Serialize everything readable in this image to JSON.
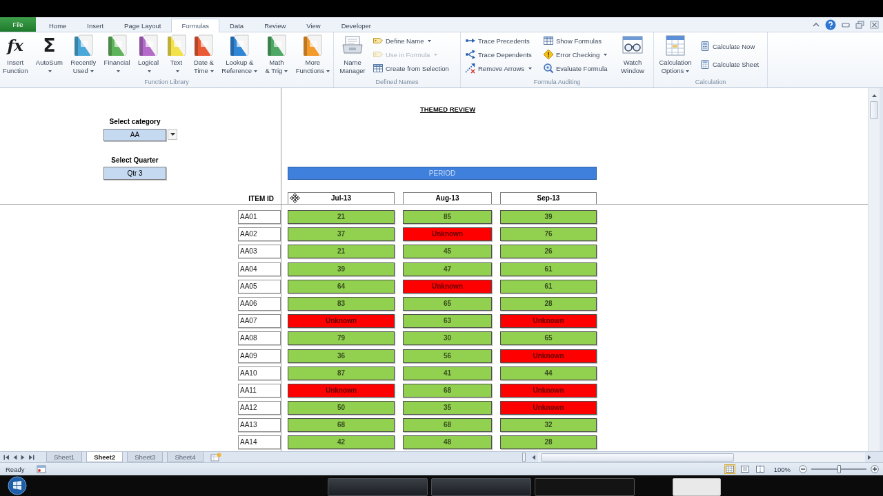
{
  "file_button": {
    "label": "File"
  },
  "tabs": [
    {
      "label": "Home",
      "selected": false
    },
    {
      "label": "Insert",
      "selected": false
    },
    {
      "label": "Page Layout",
      "selected": false
    },
    {
      "label": "Formulas",
      "selected": true
    },
    {
      "label": "Data",
      "selected": false
    },
    {
      "label": "Review",
      "selected": false
    },
    {
      "label": "View",
      "selected": false
    },
    {
      "label": "Developer",
      "selected": false
    }
  ],
  "function_library": {
    "label": "Function Library",
    "buttons": [
      {
        "kind": "glyph",
        "glyph": "fx",
        "lines": [
          "Insert",
          "Function"
        ],
        "menu": false
      },
      {
        "kind": "glyph",
        "glyph": "Σ",
        "lines": [
          "AutoSum"
        ],
        "menu": true
      },
      {
        "kind": "book",
        "color": "#4aa8d8",
        "lines": [
          "Recently",
          "Used"
        ],
        "menu": true
      },
      {
        "kind": "book",
        "color": "#5fb35a",
        "lines": [
          "Financial"
        ],
        "menu": true
      },
      {
        "kind": "book",
        "color": "#b46ac9",
        "lines": [
          "Logical"
        ],
        "menu": true
      },
      {
        "kind": "book",
        "color": "#f2e14a",
        "lines": [
          "Text"
        ],
        "menu": true
      },
      {
        "kind": "book",
        "color": "#ea5b35",
        "lines": [
          "Date &",
          "Time"
        ],
        "menu": true
      },
      {
        "kind": "book",
        "color": "#2f86d6",
        "lines": [
          "Lookup &",
          "Reference"
        ],
        "menu": true
      },
      {
        "kind": "book",
        "color": "#4ea865",
        "lines": [
          "Math",
          "& Trig"
        ],
        "menu": true
      },
      {
        "kind": "book",
        "color": "#f39a2c",
        "lines": [
          "More",
          "Functions"
        ],
        "menu": true
      }
    ]
  },
  "defined_names": {
    "label": "Defined Names",
    "manager": {
      "lines": [
        "Name",
        "Manager"
      ]
    },
    "items": [
      {
        "label": "Define Name",
        "menu": true,
        "disabled": false
      },
      {
        "label": "Use in Formula",
        "menu": true,
        "disabled": true
      },
      {
        "label": "Create from Selection",
        "menu": false,
        "disabled": false
      }
    ]
  },
  "formula_auditing": {
    "label": "Formula Auditing",
    "columns": [
      {
        "items": [
          {
            "label": "Trace Precedents",
            "menu": false
          },
          {
            "label": "Trace Dependents",
            "menu": false
          },
          {
            "label": "Remove Arrows",
            "menu": true
          }
        ]
      },
      {
        "items": [
          {
            "label": "Show Formulas",
            "menu": false
          },
          {
            "label": "Error Checking",
            "menu": true
          },
          {
            "label": "Evaluate Formula",
            "menu": false
          }
        ]
      }
    ],
    "watch": {
      "lines": [
        "Watch",
        "Window"
      ]
    }
  },
  "calculation": {
    "label": "Calculation",
    "options": {
      "lines": [
        "Calculation",
        "Options"
      ],
      "menu": true
    },
    "items": [
      {
        "label": "Calculate Now"
      },
      {
        "label": "Calculate Sheet"
      }
    ]
  },
  "sheet": {
    "title": "THEMED REVIEW",
    "category": {
      "label": "Select category",
      "value": "AA"
    },
    "quarter": {
      "label": "Select Quarter",
      "value": "Qtr 3"
    },
    "period": "PERIOD",
    "id_header": "ITEM ID",
    "columns": [
      "Jul-13",
      "Aug-13",
      "Sep-13"
    ],
    "rows": [
      {
        "id": "AA01",
        "cells": [
          {
            "value": "21",
            "color": "#92d050"
          },
          {
            "value": "85",
            "color": "#92d050"
          },
          {
            "value": "39",
            "color": "#92d050"
          }
        ]
      },
      {
        "id": "AA02",
        "cells": [
          {
            "value": "37",
            "color": "#92d050"
          },
          {
            "value": "Unknown",
            "color": "#ff0000"
          },
          {
            "value": "76",
            "color": "#92d050"
          }
        ]
      },
      {
        "id": "AA03",
        "cells": [
          {
            "value": "21",
            "color": "#92d050"
          },
          {
            "value": "45",
            "color": "#92d050"
          },
          {
            "value": "26",
            "color": "#92d050"
          }
        ]
      },
      {
        "id": "AA04",
        "cells": [
          {
            "value": "39",
            "color": "#92d050"
          },
          {
            "value": "47",
            "color": "#92d050"
          },
          {
            "value": "61",
            "color": "#92d050"
          }
        ]
      },
      {
        "id": "AA05",
        "cells": [
          {
            "value": "64",
            "color": "#92d050"
          },
          {
            "value": "Unknown",
            "color": "#ff0000"
          },
          {
            "value": "61",
            "color": "#92d050"
          }
        ]
      },
      {
        "id": "AA06",
        "cells": [
          {
            "value": "83",
            "color": "#92d050"
          },
          {
            "value": "65",
            "color": "#92d050"
          },
          {
            "value": "28",
            "color": "#92d050"
          }
        ]
      },
      {
        "id": "AA07",
        "cells": [
          {
            "value": "Unknown",
            "color": "#ff0000"
          },
          {
            "value": "63",
            "color": "#92d050"
          },
          {
            "value": "Unknown",
            "color": "#ff0000"
          }
        ]
      },
      {
        "id": "AA08",
        "cells": [
          {
            "value": "79",
            "color": "#92d050"
          },
          {
            "value": "30",
            "color": "#92d050"
          },
          {
            "value": "65",
            "color": "#92d050"
          }
        ]
      },
      {
        "id": "AA09",
        "cells": [
          {
            "value": "36",
            "color": "#92d050"
          },
          {
            "value": "56",
            "color": "#92d050"
          },
          {
            "value": "Unknown",
            "color": "#ff0000"
          }
        ]
      },
      {
        "id": "AA10",
        "cells": [
          {
            "value": "87",
            "color": "#92d050"
          },
          {
            "value": "41",
            "color": "#92d050"
          },
          {
            "value": "44",
            "color": "#92d050"
          }
        ]
      },
      {
        "id": "AA11",
        "cells": [
          {
            "value": "Unknown",
            "color": "#ff0000"
          },
          {
            "value": "68",
            "color": "#92d050"
          },
          {
            "value": "Unknown",
            "color": "#ff0000"
          }
        ]
      },
      {
        "id": "AA12",
        "cells": [
          {
            "value": "50",
            "color": "#92d050"
          },
          {
            "value": "35",
            "color": "#92d050"
          },
          {
            "value": "Unknown",
            "color": "#ff0000"
          }
        ]
      },
      {
        "id": "AA13",
        "cells": [
          {
            "value": "68",
            "color": "#92d050"
          },
          {
            "value": "68",
            "color": "#92d050"
          },
          {
            "value": "32",
            "color": "#92d050"
          }
        ]
      },
      {
        "id": "AA14",
        "cells": [
          {
            "value": "42",
            "color": "#92d050"
          },
          {
            "value": "48",
            "color": "#92d050"
          },
          {
            "value": "28",
            "color": "#92d050"
          }
        ]
      }
    ]
  },
  "sheet_tabs": [
    {
      "label": "Sheet1",
      "selected": false
    },
    {
      "label": "Sheet2",
      "selected": true
    },
    {
      "label": "Sheet3",
      "selected": false
    },
    {
      "label": "Sheet4",
      "selected": false
    }
  ],
  "status_bar": {
    "status": "Ready",
    "views": [
      {
        "selected": true
      },
      {
        "selected": false
      },
      {
        "selected": false
      }
    ],
    "zoom": "100%",
    "zoom_slider": {
      "level": 0.5
    }
  }
}
